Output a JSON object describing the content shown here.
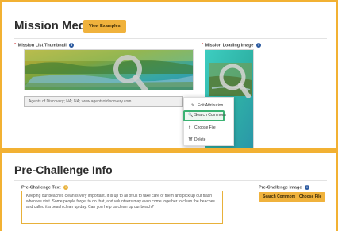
{
  "mission_media": {
    "title": "Mission Media",
    "view_examples_label": "View Examples",
    "thumbnail_label": "Mission List Thumbnail",
    "loading_image_label": "Mission Loading Image",
    "attribution_value": "Agents of Discovery; NA; NA; www.agentsofdiscovery.com",
    "edit_attribution_label": "Edit Attribution",
    "menu": [
      {
        "label": "Search Commons",
        "icon": "search-icon"
      },
      {
        "label": "Choose File",
        "icon": "upload-icon"
      },
      {
        "label": "Delete",
        "icon": "trash-icon"
      }
    ]
  },
  "pre_challenge": {
    "title": "Pre-Challenge Info",
    "text_label": "Pre-Challenge Text",
    "text_value": "Keeping our beaches clean is very important.  It is up to all of us to take care of them and pick up our trash when we visit.  Some people forget to do that, and volunteers may even come together to clean the beaches and called it a beach clean up day.  Can you help us clean up our beach?",
    "image_label": "Pre-Challenge Image",
    "search_commons_label": "Search Commons",
    "choose_file_label": "Choose File"
  },
  "colors": {
    "accent": "#f2b133",
    "highlight": "#3bb273",
    "info_icon": "#2c5aa0"
  }
}
